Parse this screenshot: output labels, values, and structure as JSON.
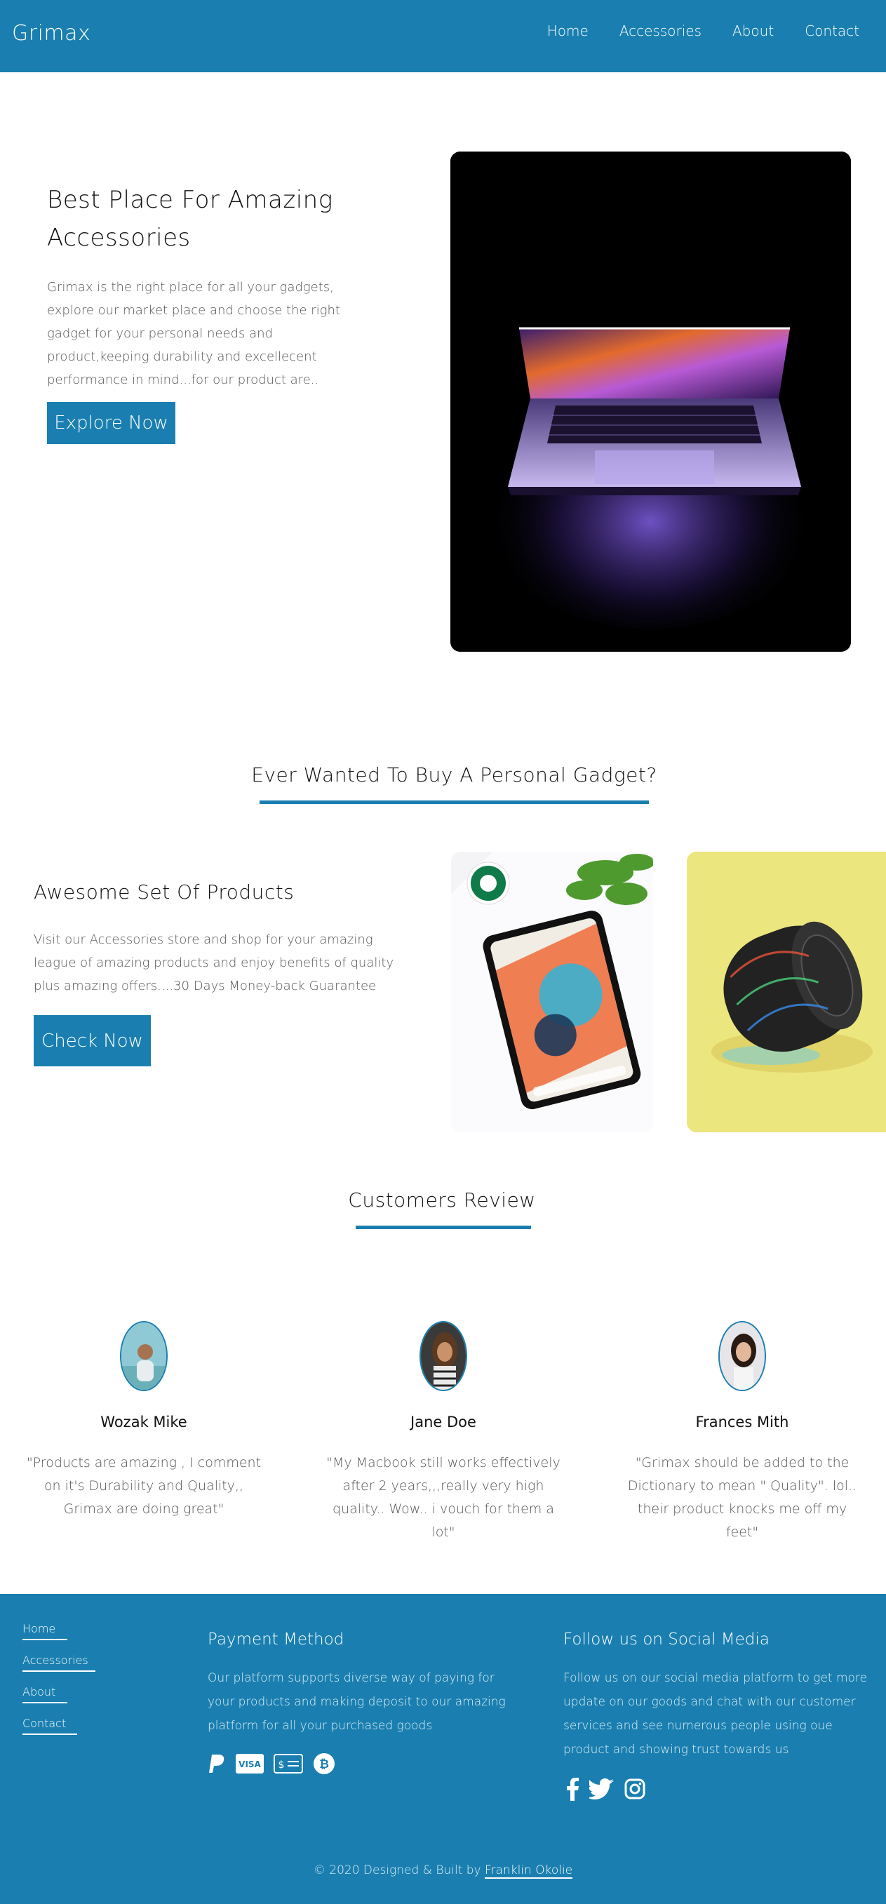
{
  "nav": {
    "brand": "Grimax",
    "links": [
      "Home",
      "Accessories",
      "About",
      "Contact"
    ]
  },
  "hero": {
    "title": "Best Place For Amazing Accessories",
    "text": "Grimax is the right place for all your gadgets, explore our market place and choose the right gadget for your personal needs and product,keeping durability and excellecent performance in mind...for our product are..",
    "button": "Explore Now"
  },
  "gadget_section": {
    "title": "Ever Wanted To Buy A Personal Gadget?"
  },
  "products": {
    "title": "Awesome Set Of Products",
    "text": "Visit our Accessories store and shop for your amazing league of amazing products and enjoy benefits of quality plus amazing offers....30 Days Money-back Guarantee",
    "button": "Check Now"
  },
  "reviews": {
    "title": "Customers Review",
    "items": [
      {
        "name": "Wozak Mike",
        "text": "\"Products are amazing , I comment on it's Durability and Quality,, Grimax are doing great\""
      },
      {
        "name": "Jane Doe",
        "text": "\"My Macbook still works effectively after 2 years,,,really very high quality.. Wow.. i vouch for them a lot\""
      },
      {
        "name": "Frances Mith",
        "text": "\"Grimax should be added to the Dictionary to mean \" Quality\". lol.. their product knocks me off my feet\""
      }
    ]
  },
  "footer": {
    "links": [
      "Home",
      "Accessories",
      "About",
      "Contact"
    ],
    "payment": {
      "title": "Payment Method",
      "text": "Our platform supports diverse way of paying for your products and making deposit to our amazing platform for all your purchased goods",
      "icons": [
        "paypal-icon",
        "visa-icon",
        "credit-card-icon",
        "bitcoin-icon"
      ]
    },
    "social": {
      "title": "Follow us on Social Media",
      "text": "Follow us on our social media platform to get more update on our goods and chat with our customer services and see numerous people using oue product and showing trust towards us",
      "icons": [
        "facebook-icon",
        "twitter-icon",
        "instagram-icon"
      ]
    },
    "copyright_prefix": "© 2020 Designed & Built by",
    "author": "Franklin Okolie"
  },
  "colors": {
    "brand": "#1a7fb0",
    "text": "#555555",
    "heading": "#111111"
  }
}
